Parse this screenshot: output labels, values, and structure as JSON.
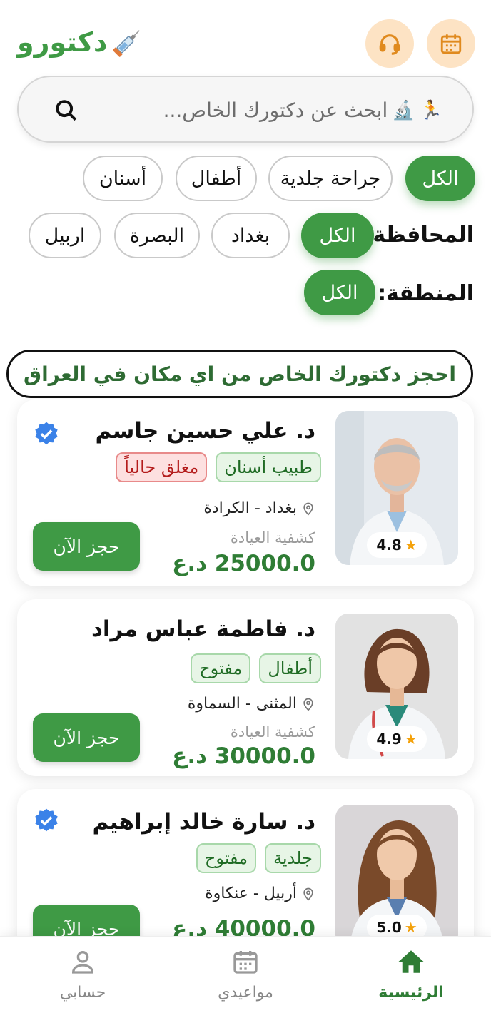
{
  "header": {
    "logo_text": "دكتورو",
    "logo_icon": "syringe-icon",
    "calendar_icon": "calendar-icon",
    "support_icon": "headset-icon"
  },
  "search": {
    "placeholder": "ابحث عن دكتورك الخاص...",
    "icons": [
      "runner-icon",
      "microscope-icon"
    ]
  },
  "filters": {
    "specialties": [
      "الكل",
      "جراحة جلدية",
      "أطفال",
      "أسنان"
    ],
    "governorate_label": "المحافظة:",
    "governorates": [
      "الكل",
      "بغداد",
      "البصرة",
      "اربيل"
    ],
    "area_label": "المنطقة:",
    "areas": [
      "الكل"
    ]
  },
  "banner": "احجز دكتورك الخاص من اي مكان في العراق",
  "doctors": [
    {
      "name": "د. علي حسين جاسم",
      "tags": [
        "طبيب أسنان",
        "مغلق حالياً"
      ],
      "location": "بغداد - الكرادة",
      "fee_label": "كشفية العيادة",
      "price": "25000.0 د.ع",
      "rating": "4.8",
      "book_label": "حجز الآن",
      "verified": true
    },
    {
      "name": "د. فاطمة عباس مراد",
      "tags": [
        "أطفال",
        "مفتوح"
      ],
      "location": "المثنى - السماوة",
      "fee_label": "كشفية العيادة",
      "price": "30000.0 د.ع",
      "rating": "4.9",
      "book_label": "حجز الآن",
      "verified": false
    },
    {
      "name": "د. سارة خالد إبراهيم",
      "tags": [
        "جلدية",
        "مفتوح"
      ],
      "location": "أربيل - عنكاوة",
      "price": "40000.0 د.ع",
      "rating": "5.0",
      "book_label": "حجز الآن",
      "verified": true
    }
  ],
  "bottom_nav": {
    "home": "الرئيسية",
    "appointments": "مواعيدي",
    "account": "حسابي"
  },
  "colors": {
    "primary": "#3f9a45",
    "accent_soft": "#fde3c4",
    "closed": "#b41c1c"
  }
}
